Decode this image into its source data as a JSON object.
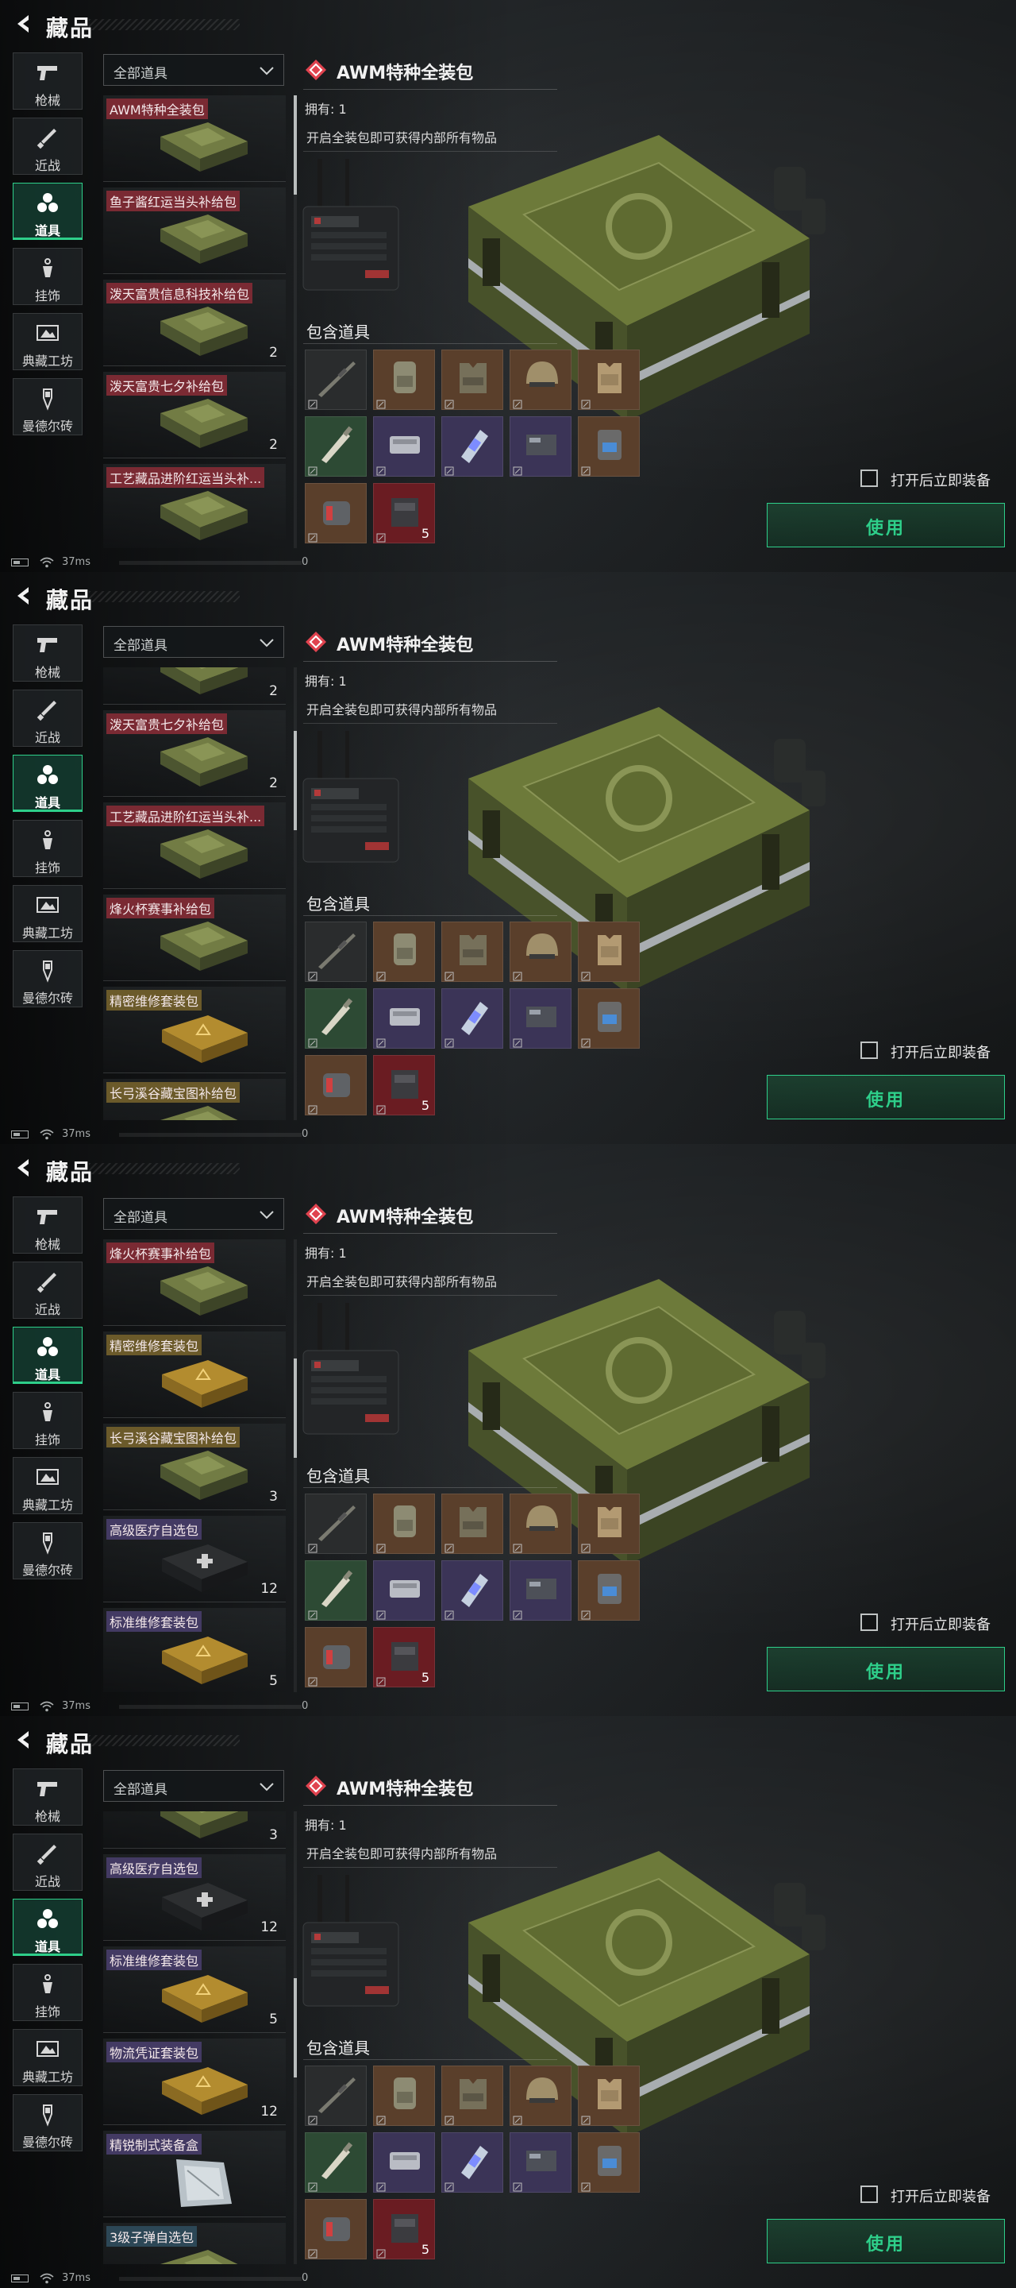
{
  "screen": {
    "title": "藏品",
    "back_icon": "back-arrow-icon",
    "categories": [
      {
        "label": "枪械",
        "icon": "pistol-icon",
        "active": false
      },
      {
        "label": "近战",
        "icon": "knife-icon",
        "active": false
      },
      {
        "label": "道具",
        "icon": "items-icon",
        "active": true
      },
      {
        "label": "挂饰",
        "icon": "charm-icon",
        "active": false
      },
      {
        "label": "典藏工坊",
        "icon": "workshop-icon",
        "active": false
      },
      {
        "label": "曼德尔砖",
        "icon": "brick-icon",
        "active": false
      }
    ],
    "filter": {
      "value": "全部道具",
      "icon": "chevron-down-icon"
    },
    "selected": {
      "name": "AWM特种全装包",
      "icon": "rarity-diamond-icon",
      "owned_label": "拥有:",
      "owned_value": "1",
      "description": "开启全装包即可获得内部所有物品"
    },
    "contents_title": "包含道具",
    "contents": [
      {
        "icon": "sniper-rifle-icon",
        "bg": "#2a2c2d",
        "qty": ""
      },
      {
        "icon": "backpack-icon",
        "bg": "#5a3f2b",
        "qty": ""
      },
      {
        "icon": "tactical-vest-icon",
        "bg": "#5a3f2b",
        "qty": ""
      },
      {
        "icon": "helmet-icon",
        "bg": "#5a3f2b",
        "qty": ""
      },
      {
        "icon": "body-armor-icon",
        "bg": "#5a3f2b",
        "qty": ""
      },
      {
        "icon": "syringe-icon",
        "bg": "#2d4a34",
        "qty": ""
      },
      {
        "icon": "ammo-box-icon",
        "bg": "#3b3457",
        "qty": ""
      },
      {
        "icon": "bandage-icon",
        "bg": "#3b3457",
        "qty": ""
      },
      {
        "icon": "repair-kit-icon",
        "bg": "#3b3457",
        "qty": ""
      },
      {
        "icon": "medkit-icon",
        "bg": "#5a3f2b",
        "qty": ""
      },
      {
        "icon": "canister-icon",
        "bg": "#5a3f2b",
        "qty": ""
      },
      {
        "icon": "ammo-crate-icon",
        "bg": "#6a1c22",
        "qty": "5"
      }
    ],
    "equip_label": "打开后立即装备",
    "use_label": "使用",
    "status": {
      "ping": "37ms",
      "counter": "0",
      "battery_icon": "battery-icon",
      "wifi_icon": "wifi-icon"
    },
    "accent": "#2ecf8a"
  },
  "frames": [
    {
      "list": [
        {
          "name": "AWM特种全装包",
          "qty": "",
          "art": "green-crate",
          "tag": "#7a2a33"
        },
        {
          "name": "鱼子酱红运当头补给包",
          "qty": "",
          "art": "green-crate",
          "tag": "#7a2a33"
        },
        {
          "name": "泼天富贵信息科技补给包",
          "qty": "2",
          "art": "green-crate",
          "tag": "#7a2a33"
        },
        {
          "name": "泼天富贵七夕补给包",
          "qty": "2",
          "art": "green-crate",
          "tag": "#7a2a33"
        },
        {
          "name": "工艺藏品进阶红运当头补...",
          "qty": "",
          "art": "green-crate",
          "tag": "#7a2a33"
        }
      ]
    },
    {
      "list": [
        {
          "name": "",
          "qty": "2",
          "art": "green-crate",
          "tag": "#7a2a33"
        },
        {
          "name": "泼天富贵七夕补给包",
          "qty": "2",
          "art": "green-crate",
          "tag": "#7a2a33"
        },
        {
          "name": "工艺藏品进阶红运当头补...",
          "qty": "",
          "art": "green-crate",
          "tag": "#7a2a33"
        },
        {
          "name": "烽火杯赛事补给包",
          "qty": "",
          "art": "green-crate",
          "tag": "#7a2a33"
        },
        {
          "name": "精密维修套装包",
          "qty": "",
          "art": "yellow-case",
          "tag": "#6b5a2a"
        },
        {
          "name": "长弓溪谷藏宝图补给包",
          "qty": "",
          "art": "green-crate",
          "tag": "#6b5a2a"
        }
      ]
    },
    {
      "list": [
        {
          "name": "烽火杯赛事补给包",
          "qty": "",
          "art": "green-crate",
          "tag": "#7a2a33"
        },
        {
          "name": "精密维修套装包",
          "qty": "",
          "art": "yellow-case",
          "tag": "#6b5a2a"
        },
        {
          "name": "长弓溪谷藏宝图补给包",
          "qty": "3",
          "art": "green-crate",
          "tag": "#6b5a2a"
        },
        {
          "name": "高级医疗自选包",
          "qty": "12",
          "art": "black-medcase",
          "tag": "#433a63"
        },
        {
          "name": "标准维修套装包",
          "qty": "5",
          "art": "yellow-case",
          "tag": "#433a63"
        }
      ]
    },
    {
      "list": [
        {
          "name": "",
          "qty": "3",
          "art": "green-crate",
          "tag": "#6b5a2a"
        },
        {
          "name": "高级医疗自选包",
          "qty": "12",
          "art": "black-medcase",
          "tag": "#433a63"
        },
        {
          "name": "标准维修套装包",
          "qty": "5",
          "art": "yellow-case",
          "tag": "#433a63"
        },
        {
          "name": "物流凭证套装包",
          "qty": "12",
          "art": "yellow-case",
          "tag": "#433a63"
        },
        {
          "name": "精锐制式装备盒",
          "qty": "",
          "art": "silver-box",
          "tag": "#433a63"
        },
        {
          "name": "3级子弹自选包",
          "qty": "",
          "art": "green-crate",
          "tag": "#2c4756"
        }
      ]
    }
  ]
}
